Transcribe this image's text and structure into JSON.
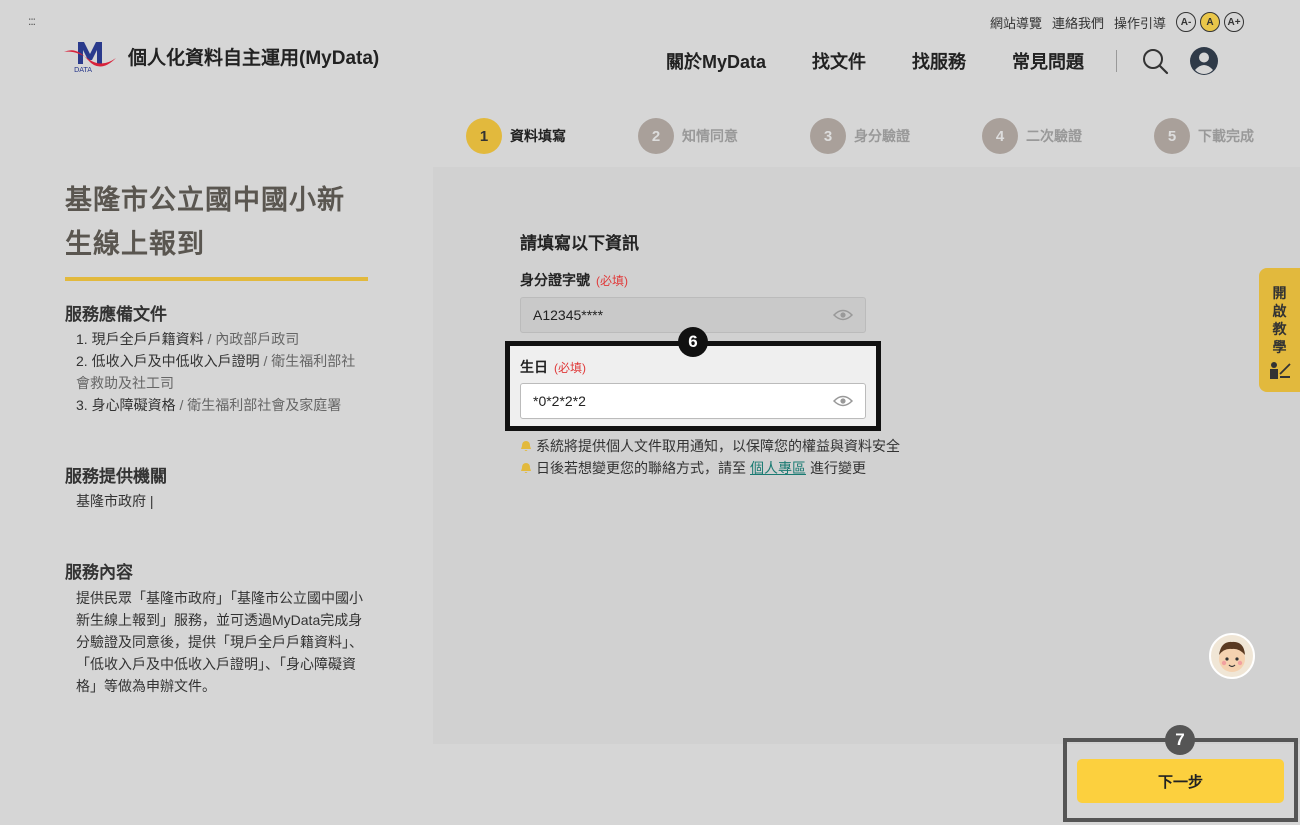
{
  "utility": {
    "sitemap": "網站導覽",
    "contact": "連絡我們",
    "guide": "操作引導",
    "font_small": "A-",
    "font_normal": "A",
    "font_large": "A+"
  },
  "header": {
    "logo_text": "個人化資料自主運用(MyData)",
    "logo_sub": "DATA"
  },
  "nav": {
    "items": [
      "關於MyData",
      "找文件",
      "找服務",
      "常見問題"
    ]
  },
  "steps": [
    {
      "num": "1",
      "label": "資料填寫"
    },
    {
      "num": "2",
      "label": "知情同意"
    },
    {
      "num": "3",
      "label": "身分驗證"
    },
    {
      "num": "4",
      "label": "二次驗證"
    },
    {
      "num": "5",
      "label": "下載完成"
    }
  ],
  "service": {
    "title": "基隆市公立國中國小新生線上報到",
    "docs_heading": "服務應備文件",
    "docs": [
      {
        "name": "1. 現戶全戶戶籍資料",
        "sep": " / ",
        "org": "內政部戶政司"
      },
      {
        "name": "2. 低收入戶及中低收入戶證明",
        "sep": " / ",
        "org": "衛生福利部社會救助及社工司"
      },
      {
        "name": "3. 身心障礙資格",
        "sep": " / ",
        "org": "衛生福利部社會及家庭署"
      }
    ],
    "provider_heading": "服務提供機關",
    "provider": "基隆市政府 |",
    "content_heading": "服務內容",
    "content": "提供民眾「基隆市政府」「基隆市公立國中國小新生線上報到」服務，並可透過MyData完成身分驗證及同意後，提供「現戶全戶戶籍資料」、「低收入戶及中低收入戶證明」、「身心障礙資格」等做為申辦文件。"
  },
  "form": {
    "heading": "請填寫以下資訊",
    "id_label": "身分證字號",
    "required": "(必填)",
    "id_value": "A12345****",
    "birth_label": "生日",
    "birth_value": "*0*2*2*2",
    "note1": "系統將提供個人文件取用通知，以保障您的權益與資料安全",
    "note2_pre": "日後若想變更您的聯絡方式，請至",
    "note2_link": "個人專區",
    "note2_post": "進行變更"
  },
  "tutorial": {
    "label": "開啟教學"
  },
  "markers": {
    "birth": "6",
    "next": "7"
  },
  "actions": {
    "next": "下一步"
  },
  "colors": {
    "accent": "#e2b93d",
    "button": "#fcd03e",
    "required": "#e03a3a",
    "link": "#1a7a72"
  }
}
